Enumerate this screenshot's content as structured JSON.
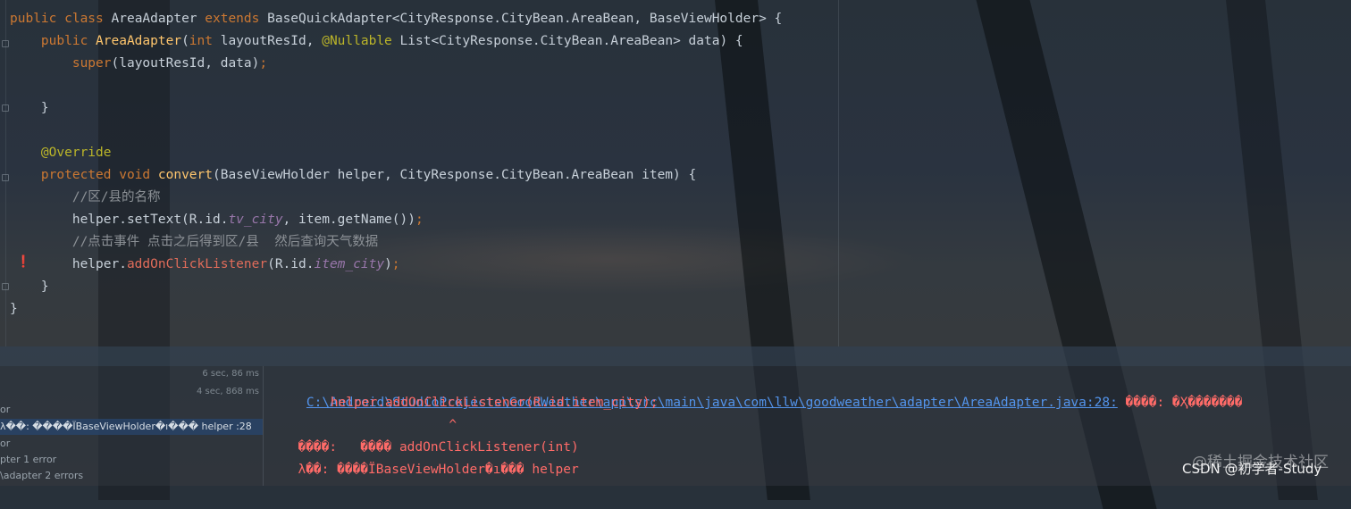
{
  "editor": {
    "lines": [
      [
        {
          "t": "public class ",
          "c": "kw"
        },
        {
          "t": "AreaAdapter ",
          "c": "pl"
        },
        {
          "t": "extends ",
          "c": "kw"
        },
        {
          "t": "BaseQuickAdapter<CityResponse.CityBean.AreaBean, BaseViewHolder> {",
          "c": "pl"
        }
      ],
      [
        {
          "t": "    public ",
          "c": "kw"
        },
        {
          "t": "AreaAdapter",
          "c": "fn"
        },
        {
          "t": "(",
          "c": "pl"
        },
        {
          "t": "int ",
          "c": "kw"
        },
        {
          "t": "layoutResId, ",
          "c": "pl"
        },
        {
          "t": "@Nullable ",
          "c": "an"
        },
        {
          "t": "List<CityResponse.CityBean.AreaBean> data) {",
          "c": "pl"
        }
      ],
      [
        {
          "t": "        super",
          "c": "kw"
        },
        {
          "t": "(layoutResId, data)",
          "c": "pl"
        },
        {
          "t": ";",
          "c": "kw"
        }
      ],
      [],
      [
        {
          "t": "    }",
          "c": "pl"
        }
      ],
      [],
      [
        {
          "t": "    @Override",
          "c": "an"
        }
      ],
      [
        {
          "t": "    protected void ",
          "c": "kw"
        },
        {
          "t": "convert",
          "c": "fn"
        },
        {
          "t": "(BaseViewHolder helper, CityResponse.CityBean.AreaBean item) {",
          "c": "pl"
        }
      ],
      [
        {
          "t": "        //区/县的名称",
          "c": "cm"
        }
      ],
      [
        {
          "t": "        helper.setText(R.id.",
          "c": "pl"
        },
        {
          "t": "tv_city",
          "c": "it"
        },
        {
          "t": ", item.getName())",
          "c": "pl"
        },
        {
          "t": ";",
          "c": "kw"
        }
      ],
      [
        {
          "t": "        //点击事件 点击之后得到区/县  然后查询天气数据",
          "c": "cm"
        }
      ],
      [
        {
          "t": "        helper.",
          "c": "pl"
        },
        {
          "t": "addOnClickListener",
          "c": "er"
        },
        {
          "t": "(R.id.",
          "c": "pl"
        },
        {
          "t": "item_city",
          "c": "it"
        },
        {
          "t": ")",
          "c": "pl"
        },
        {
          "t": ";",
          "c": "kw"
        }
      ],
      [
        {
          "t": "    }",
          "c": "pl"
        }
      ],
      [
        {
          "t": "}",
          "c": "pl"
        }
      ]
    ]
  },
  "build_tree": {
    "rows": [
      {
        "label": "",
        "time": "6 sec, 86 ms"
      },
      {
        "label": "",
        "time": "4 sec, 868 ms"
      },
      {
        "label": "or",
        "time": ""
      },
      {
        "label": "λ��: ����ΪBaseViewHolder�ı��� helper :28",
        "time": "",
        "selected": true
      },
      {
        "label": "or",
        "time": ""
      },
      {
        "label": "pter 1 error",
        "time": ""
      },
      {
        "label": "\\adapter 2 errors",
        "time": ""
      }
    ]
  },
  "console": {
    "path_link": "C:\\Android\\StudioProjects\\GoodWeather\\app\\src\\main\\java\\com\\llw\\goodweather\\adapter\\AreaAdapter.java:28:",
    "path_error": " ����: �Ҳ�������",
    "code_line": "        helper.addOnClickListener(R.id.item_city);",
    "caret_line": "                 ^",
    "symbol_line": "  ����:   ���� addOnClickListener(int)",
    "location_line": "  λ��: ����ΪBaseViewHolder�ı��� helper"
  },
  "watermark": {
    "site": "@稀土掘金技术社区",
    "author": "CSDN @初学者-Study"
  }
}
